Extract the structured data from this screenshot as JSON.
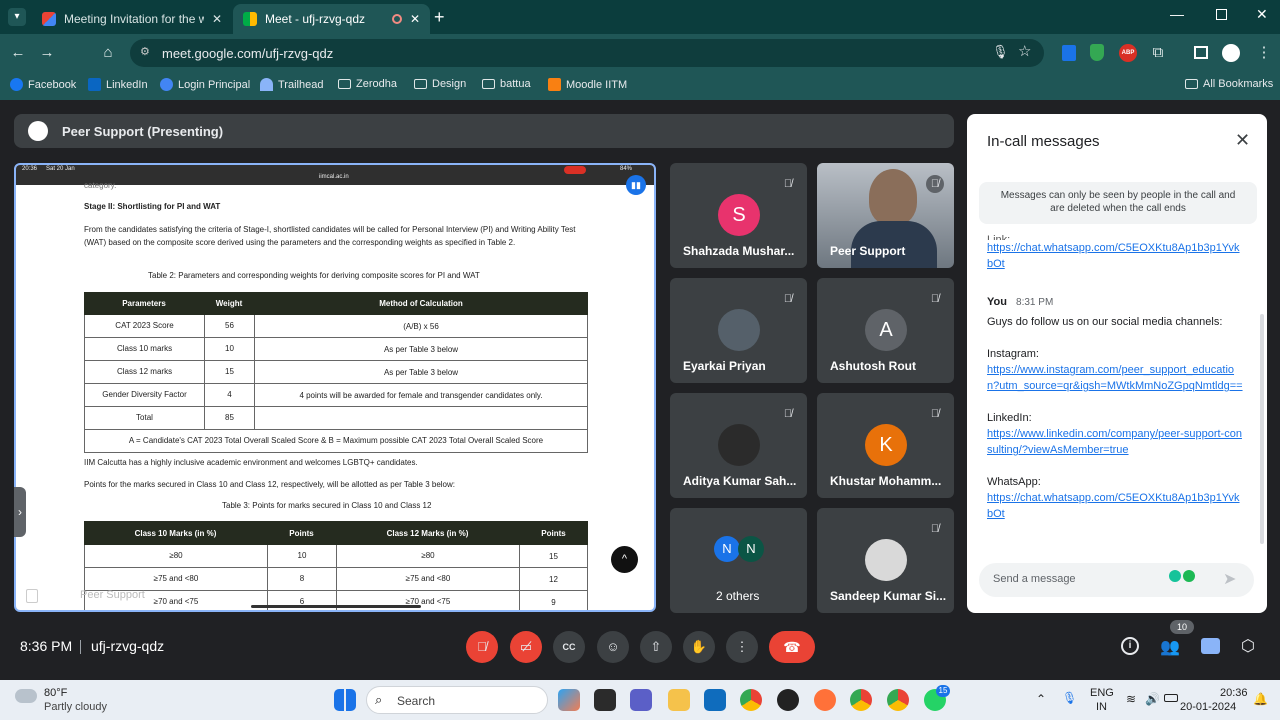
{
  "browser": {
    "tabs": [
      {
        "title": "Meeting Invitation for the webi"
      },
      {
        "title": "Meet - ufj-rzvg-qdz"
      }
    ],
    "url": "meet.google.com/ufj-rzvg-qdz",
    "bookmarks": [
      "Facebook",
      "LinkedIn",
      "Login Principal",
      "Trailhead",
      "Zerodha",
      "Design",
      "battua",
      "Moodle IITM"
    ],
    "all_bookmarks": "All Bookmarks",
    "abp_badge": "ABP"
  },
  "presentation": {
    "title": "Peer Support (Presenting)",
    "status_time": "20:36",
    "status_date": "Sat 20 Jan",
    "status_url": "iimcal.ac.in",
    "status_battery": "84%",
    "doc_top_fragment": "category.",
    "stage_heading": "Stage II: Shortlisting for PI and WAT",
    "stage_para": "From the candidates satisfying the criteria of Stage-I, shortlisted candidates will be called for Personal Interview (PI) and Writing Ability Test (WAT) based on the composite score derived using the parameters and the corresponding weights as specified in Table 2.",
    "table2_caption": "Table 2: Parameters and corresponding weights for deriving composite scores for PI and WAT",
    "table2_headers": [
      "Parameters",
      "Weight",
      "Method of Calculation"
    ],
    "table2_rows": [
      [
        "CAT 2023 Score",
        "56",
        "(A/B) x 56"
      ],
      [
        "Class 10 marks",
        "10",
        "As per Table 3 below"
      ],
      [
        "Class 12 marks",
        "15",
        "As per Table 3 below"
      ],
      [
        "Gender Diversity Factor",
        "4",
        "4 points will be awarded for female and transgender candidates only."
      ],
      [
        "Total",
        "85",
        ""
      ]
    ],
    "table2_footnote": "A = Candidate's CAT 2023 Total Overall Scaled Score & B = Maximum possible CAT 2023 Total Overall Scaled Score",
    "inclusive_line": "IIM Calcutta has a highly inclusive academic environment and welcomes LGBTQ+ candidates.",
    "points_line": "Points for the marks secured in Class 10 and Class 12, respectively, will be allotted as per Table 3 below:",
    "table3_caption": "Table 3: Points for marks secured in Class 10 and Class 12",
    "table3_headers": [
      "Class 10 Marks (in %)",
      "Points",
      "Class 12 Marks (in %)",
      "Points"
    ],
    "table3_rows": [
      [
        "≥80",
        "10",
        "≥80",
        "15"
      ],
      [
        "≥75 and <80",
        "8",
        "≥75 and <80",
        "12"
      ],
      [
        "≥70 and <75",
        "6",
        "≥70 and <75",
        "9"
      ]
    ],
    "presenter_watermark": "Peer Support"
  },
  "participants": [
    {
      "name": "Shahzada Mushar...",
      "initial": "S",
      "color": "#e8336d",
      "muted": true
    },
    {
      "name": "Peer Support",
      "initial": "",
      "color": "#6a7b8c",
      "muted": true
    },
    {
      "name": "Eyarkai Priyan",
      "initial": "",
      "color": "#55606a",
      "muted": true
    },
    {
      "name": "Ashutosh Rout",
      "initial": "A",
      "color": "#5f6368",
      "muted": true
    },
    {
      "name": "Aditya Kumar Sah...",
      "initial": "",
      "color": "#2b2b2b",
      "muted": true
    },
    {
      "name": "Khustar Mohamm...",
      "initial": "K",
      "color": "#e8710a",
      "muted": true
    },
    {
      "name": "2 others",
      "initial": "N",
      "color": "#1a73e8",
      "muted": false
    },
    {
      "name": "Sandeep Kumar Si...",
      "initial": "",
      "color": "#d9d9d9",
      "muted": true
    }
  ],
  "others_second_initial": "N",
  "chat": {
    "title": "In-call messages",
    "notice": "Messages can only be seen by people in the call and are deleted when the call ends",
    "link_whatsapp_top": "https://chat.whatsapp.com/C5EOXKtu8Ap1b3p1Yvk bOt",
    "sender": "You",
    "sent_time": "8:31 PM",
    "message_intro": "Guys do follow us on our social media channels:",
    "instagram_label": "Instagram:",
    "instagram_link": "https://www.instagram.com/peer_support_education?utm_source=qr&igsh=MWtkMmNoZGpqNmtldg==",
    "linkedin_label": "LinkedIn:",
    "linkedin_link": "https://www.linkedin.com/company/peer-support-consulting/?viewAsMember=true",
    "whatsapp_label": "WhatsApp:",
    "whatsapp_link": "https://chat.whatsapp.com/C5EOXKtu8Ap1b3p1Yvk bOt",
    "input_placeholder": "Send a message"
  },
  "meeting": {
    "time": "8:36 PM",
    "code": "ufj-rzvg-qdz",
    "people_count": "10"
  },
  "taskbar": {
    "weather_temp": "80°F",
    "weather_desc": "Partly cloudy",
    "search_placeholder": "Search",
    "lang_line1": "ENG",
    "lang_line2": "IN",
    "clock_time": "20:36",
    "clock_date": "20-01-2024",
    "badge_whatsapp": "15"
  }
}
